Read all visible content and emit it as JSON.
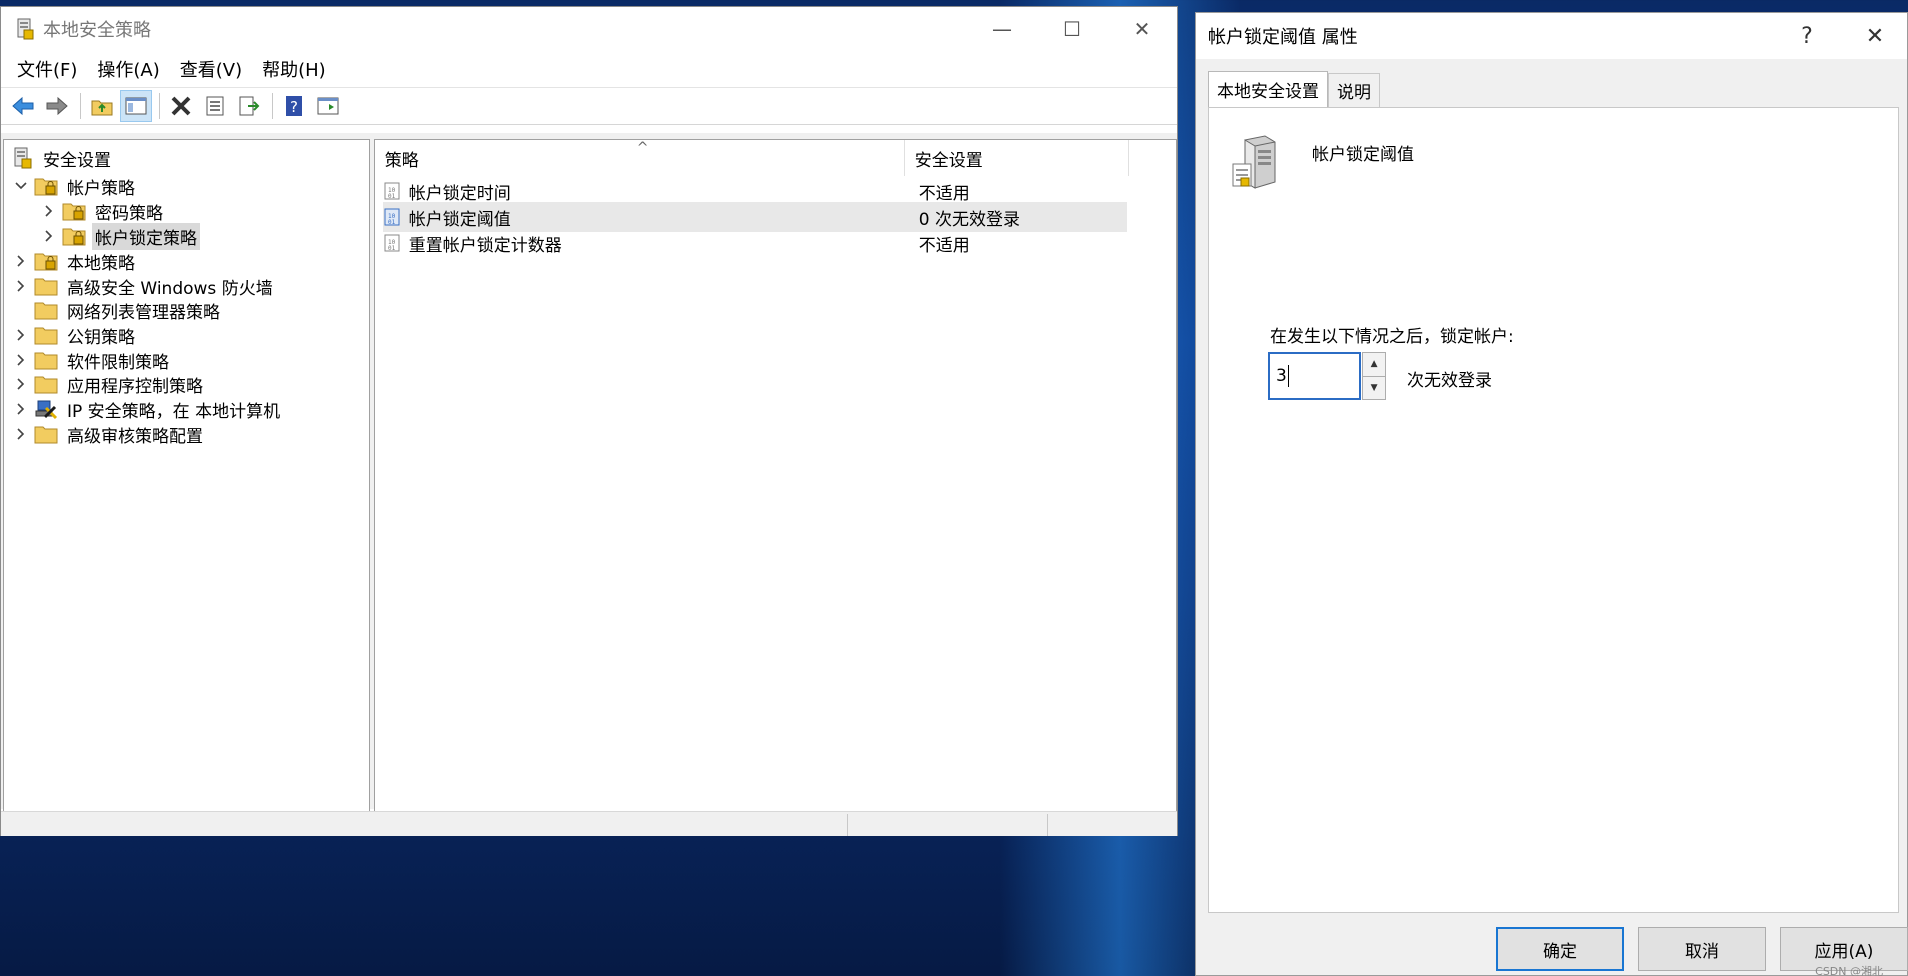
{
  "main_window": {
    "title": "本地安全策略",
    "controls": {
      "minimize": "—",
      "maximize": "☐",
      "close": "✕"
    },
    "menu": [
      "文件(F)",
      "操作(A)",
      "查看(V)",
      "帮助(H)"
    ],
    "tree": [
      {
        "label": "安全设置",
        "depth": 0,
        "expander": "none",
        "icon": "security-settings-icon"
      },
      {
        "label": "帐户策略",
        "depth": 1,
        "expander": "open",
        "icon": "locked-folder-icon"
      },
      {
        "label": "密码策略",
        "depth": 2,
        "expander": "closed",
        "icon": "locked-folder-icon"
      },
      {
        "label": "帐户锁定策略",
        "depth": 2,
        "expander": "closed",
        "icon": "locked-folder-icon",
        "selected": true
      },
      {
        "label": "本地策略",
        "depth": 1,
        "expander": "closed",
        "icon": "locked-folder-icon"
      },
      {
        "label": "高级安全 Windows 防火墙",
        "depth": 1,
        "expander": "closed",
        "icon": "folder-icon"
      },
      {
        "label": "网络列表管理器策略",
        "depth": 1,
        "expander": "none",
        "icon": "folder-icon"
      },
      {
        "label": "公钥策略",
        "depth": 1,
        "expander": "closed",
        "icon": "folder-icon"
      },
      {
        "label": "软件限制策略",
        "depth": 1,
        "expander": "closed",
        "icon": "folder-icon"
      },
      {
        "label": "应用程序控制策略",
        "depth": 1,
        "expander": "closed",
        "icon": "folder-icon"
      },
      {
        "label": "IP 安全策略，在 本地计算机",
        "depth": 1,
        "expander": "closed",
        "icon": "ip-security-icon"
      },
      {
        "label": "高级审核策略配置",
        "depth": 1,
        "expander": "closed",
        "icon": "folder-icon"
      }
    ],
    "list": {
      "columns": [
        "策略",
        "安全设置"
      ],
      "rows": [
        {
          "policy": "帐户锁定时间",
          "setting": "不适用"
        },
        {
          "policy": "帐户锁定阈值",
          "setting": "0 次无效登录",
          "selected": true
        },
        {
          "policy": "重置帐户锁定计数器",
          "setting": "不适用"
        }
      ]
    }
  },
  "dialog": {
    "title": "帐户锁定阈值 属性",
    "help": "?",
    "close": "✕",
    "tabs": [
      "本地安全设置",
      "说明"
    ],
    "policy_name": "帐户锁定阈值",
    "lock_label": "在发生以下情况之后，锁定帐户:",
    "threshold_value": "3",
    "unit_label": "次无效登录",
    "buttons": {
      "ok": "确定",
      "cancel": "取消",
      "apply": "应用(A)"
    }
  },
  "watermark": "CSDN @湘北",
  "colors": {
    "accent": "#1976d2",
    "desktop": "#0c3a8a",
    "selection": "#d9d9d9"
  }
}
